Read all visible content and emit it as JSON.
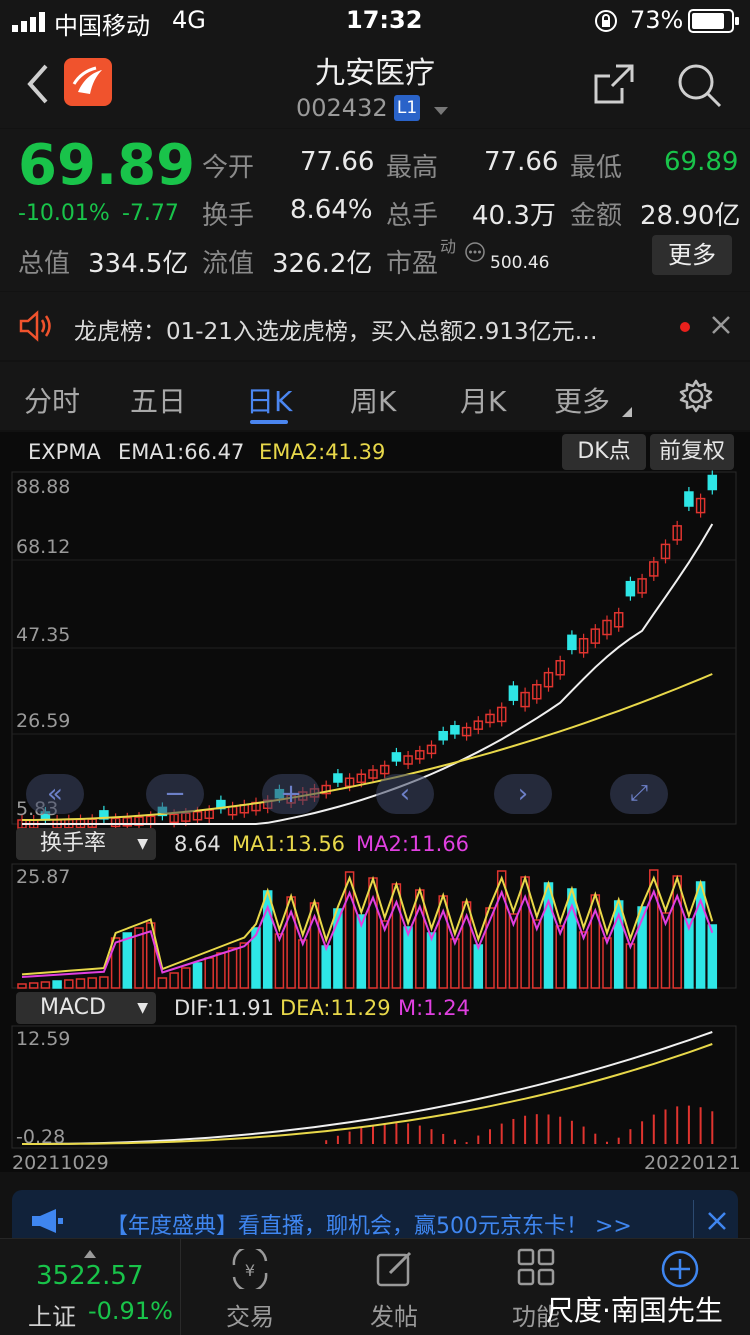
{
  "status": {
    "carrier": "中国移动",
    "network": "4G",
    "time": "17:32",
    "battery": "73%"
  },
  "header": {
    "title": "九安医疗",
    "code": "002432",
    "level": "L1"
  },
  "quote": {
    "price": "69.89",
    "change_pct": "-10.01%",
    "change": "-7.77",
    "open_label": "今开",
    "open": "77.66",
    "high_label": "最高",
    "high": "77.66",
    "low_label": "最低",
    "low": "69.89",
    "turnover_label": "换手",
    "turnover": "8.64%",
    "volume_label": "总手",
    "volume": "40.3万",
    "amount_label": "金额",
    "amount": "28.90亿",
    "mcap_label": "总值",
    "mcap": "334.5亿",
    "float_label": "流值",
    "float": "326.2亿",
    "pe_label": "市盈",
    "pe_sup": "动",
    "pe": "500.46",
    "more_label": "更多"
  },
  "notice": {
    "text": "龙虎榜：01-21入选龙虎榜，买入总额2.913亿元…"
  },
  "tabs": [
    "分时",
    "五日",
    "日K",
    "周K",
    "月K",
    "更多"
  ],
  "active_tab": 2,
  "main_chart": {
    "indicator": "EXPMA",
    "ema1": "EMA1:66.47",
    "ema2": "EMA2:41.39",
    "dk_label": "DK点",
    "adjust_label": "前复权",
    "ticks": [
      "88.88",
      "68.12",
      "47.35",
      "26.59",
      "5.83"
    ]
  },
  "turnover_chart": {
    "selector": "换手率",
    "value": "8.64",
    "ma1": "MA1:13.56",
    "ma2": "MA2:11.66",
    "top_tick": "25.87"
  },
  "macd_chart": {
    "selector": "MACD",
    "dif": "DIF:11.91",
    "dea": "DEA:11.29",
    "m": "M:1.24",
    "top_tick": "12.59",
    "bottom_tick": "-0.28",
    "start_date": "20211029",
    "end_date": "20220121"
  },
  "ad": {
    "text": "【年度盛典】看直播，聊机会，赢500元京东卡！ >>"
  },
  "bottom_bar": {
    "index_value": "3522.57",
    "index_name": "上证",
    "index_change": "-0.91%",
    "items": [
      "交易",
      "发帖",
      "功能"
    ]
  },
  "watermark": "尺度·南国先生",
  "colors": {
    "up": "#e0342f",
    "down": "#2ee6e6",
    "green": "#19c34a",
    "ema2": "#e8d84a",
    "ma2": "#e040e0"
  }
}
